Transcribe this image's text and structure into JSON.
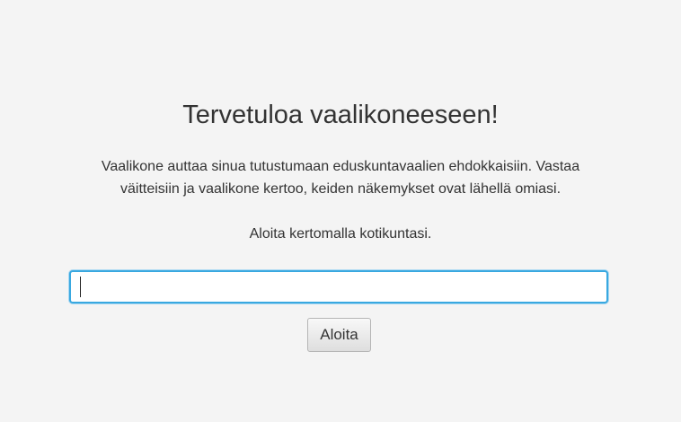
{
  "welcome": {
    "title": "Tervetuloa vaalikoneeseen!",
    "intro_line1": "Vaalikone auttaa sinua tutustumaan eduskuntavaalien ehdokkaisiin. Vastaa",
    "intro_line2": "väitteisiin ja vaalikone kertoo, keiden näkemykset ovat lähellä omiasi.",
    "prompt": "Aloita kertomalla kotikuntasi."
  },
  "municipality_input": {
    "value": "",
    "placeholder": ""
  },
  "start_button": {
    "label": "Aloita"
  },
  "colors": {
    "background": "#f4f4f4",
    "text": "#333333",
    "focus_border": "#39a8e0"
  }
}
